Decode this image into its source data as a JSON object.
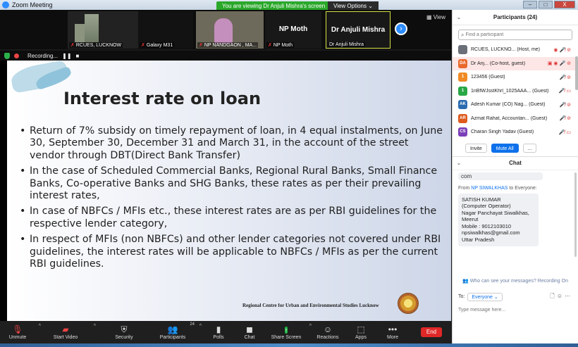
{
  "window": {
    "title": "Zoom Meeting",
    "viewing_banner": "You are viewing Dr Anjuli Mishra's screen",
    "view_options": "View Options ⌄",
    "min": "–",
    "max": "□",
    "close": "X"
  },
  "video_strip": {
    "tiles": [
      {
        "name": "RCUES, LUCKNOW"
      },
      {
        "name": "Galaxy M31"
      },
      {
        "name": "NP NANDGAON , MA..."
      },
      {
        "name": "NP Moth",
        "big": "NP Moth"
      },
      {
        "name": "Dr Anjuli Mishra",
        "big": "Dr Anjuli Mishra"
      }
    ],
    "next_icon": "›",
    "view_label": "View"
  },
  "recording": {
    "label": "Recording...",
    "pause": "❚❚",
    "stop": "■"
  },
  "slide": {
    "title": "Interest rate on loan",
    "bullets": [
      "Return of 7% subsidy on timely repayment of loan, in 4 equal instalments, on June 30, September 30, December 31 and March 31, in the account of the street vendor through DBT(Direct Bank Transfer)",
      "In the case of Scheduled Commercial Banks, Regional Rural Banks, Small Finance Banks, Co-operative Banks and SHG Banks, these rates as per their prevailing interest rates,",
      "In case of NBFCs / MFIs etc., these interest rates are as per RBI guidelines for the respective lender category,",
      "In respect of MFIs (non NBFCs) and other lender categories not covered under RBI guidelines, the interest rates will be applicable to NBFCs / MFIs as per the current RBI guidelines."
    ],
    "footer": "Regional Centre for Urban and Environmental Studies Lucknow"
  },
  "toolbar": {
    "unmute": "Unmute",
    "start_video": "Start Video",
    "security": "Security",
    "participants": "Participants",
    "participants_count": "24",
    "polls": "Polls",
    "chat": "Chat",
    "share_screen": "Share Screen",
    "reactions": "Reactions",
    "apps": "Apps",
    "more": "More",
    "end": "End"
  },
  "participants_panel": {
    "title": "Participants (24)",
    "search_placeholder": "Find a participant",
    "rows": [
      {
        "initials": "",
        "color": "#6a6f78",
        "name": "RCUES, LUCKNO... (Host, me)",
        "icons": "◉ 🎤̸ ⊘"
      },
      {
        "initials": "DA",
        "color": "#e9692c",
        "name": "Dr Anj... (Co-host, guest)",
        "icons": "▣ ◉ 🎤 ⊘"
      },
      {
        "initials": "1",
        "color": "#f08a24",
        "name": "123456 (Guest)",
        "icons": "🎤̸ ⊘"
      },
      {
        "initials": "1",
        "color": "#28a745",
        "name": "1nBfWJsstKhrl_1025AAA... (Guest)",
        "icons": "🎤̸ ▭"
      },
      {
        "initials": "AK",
        "color": "#2b6cb0",
        "name": "Adesh Kumar (CO) Nag... (Guest)",
        "icons": "🎤̸ ⊘"
      },
      {
        "initials": "AR",
        "color": "#dd5b1c",
        "name": "Azmat Rahat, Accountan... (Guest)",
        "icons": "🎤̸ ⊘"
      },
      {
        "initials": "CS",
        "color": "#7b3fb8",
        "name": "Charan Singh Yadav (Guest)",
        "icons": "🎤̸ ▭"
      }
    ],
    "invite": "Invite",
    "mute_all": "Mute All",
    "more": "..."
  },
  "chat_panel": {
    "title": "Chat",
    "prev_tail": "com",
    "from_prefix": "From",
    "sender": "NP SIWALKHAS",
    "to_word": "to",
    "recipient": "Everyone:",
    "message_lines": [
      "SATISH KUMAR",
      "(Computer Operator)",
      "Nagar Panchayat Siwalkhas,",
      "Meerut",
      "Mobile : 9012103010",
      "npsiwalkhas@gmail.com",
      "Uttar Pradesh"
    ],
    "privacy_note": "Who can see your messages? Recording On",
    "to_label": "To:",
    "to_value": "Everyone ⌄",
    "input_placeholder": "Type message here..."
  }
}
